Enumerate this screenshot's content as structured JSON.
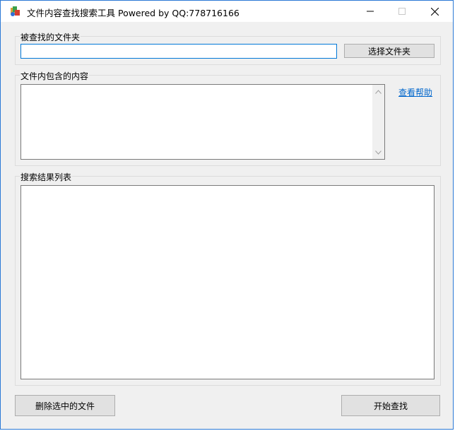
{
  "window": {
    "title": "文件内容查找搜索工具 Powered by QQ:778716166",
    "accent_color": "#2b79d6"
  },
  "folder_group": {
    "label": "被查找的文件夹",
    "path_value": "",
    "select_button": "选择文件夹"
  },
  "content_group": {
    "label": "文件内包含的内容",
    "text_value": "",
    "help_link": "查看帮助"
  },
  "results_group": {
    "label": "搜索结果列表",
    "items": []
  },
  "actions": {
    "delete_button": "删除选中的文件",
    "search_button": "开始查找"
  },
  "icons": [
    "app-icon",
    "minimize-icon",
    "maximize-icon",
    "close-icon",
    "scroll-up-icon",
    "scroll-down-icon"
  ]
}
